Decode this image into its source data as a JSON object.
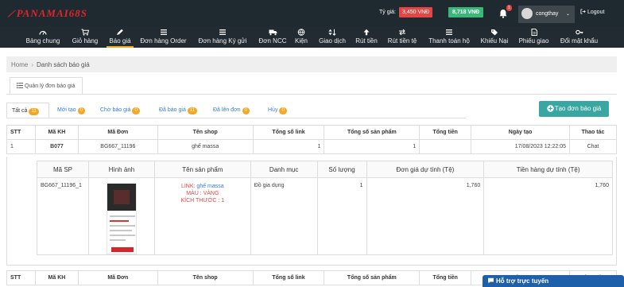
{
  "header": {
    "logo": "PANAMAI68S",
    "rate_label": "Tỷ giá:",
    "rate_value": "3,450 VNĐ",
    "wallet_value": "8,718 VNĐ",
    "notif_count": "1",
    "username": "congthay",
    "logout": "Logout"
  },
  "nav": {
    "items": [
      {
        "label": "Bảng chung",
        "icon": "dashboard-icon"
      },
      {
        "label": "Giỏ hàng",
        "icon": "cart-icon"
      },
      {
        "label": "Báo giá",
        "icon": "pencil-icon"
      },
      {
        "label": "Đơn hàng Order",
        "icon": "list-icon"
      },
      {
        "label": "Đơn hàng Ký gửi",
        "icon": "list-icon"
      },
      {
        "label": "Đơn NCC",
        "icon": "truck-icon"
      },
      {
        "label": "Kiện",
        "icon": "globe-icon"
      },
      {
        "label": "Giao dịch",
        "icon": "sort-icon"
      },
      {
        "label": "Rút tiền",
        "icon": "arrow-up-icon"
      },
      {
        "label": "Rút tiền tệ",
        "icon": "exchange-icon"
      },
      {
        "label": "Thanh toán hộ",
        "icon": "list-icon"
      },
      {
        "label": "Khiếu Nại",
        "icon": "tag-icon"
      },
      {
        "label": "Phiếu giao",
        "icon": "file-icon"
      },
      {
        "label": "Đổi mật khẩu",
        "icon": "key-icon"
      }
    ],
    "active_index": 2
  },
  "breadcrumb": {
    "home": "Home",
    "current": "Danh sách báo giá"
  },
  "section_tab": "Quản lý đơn báo giá",
  "filter_tabs": [
    {
      "label": "Tất cả",
      "count": "11"
    },
    {
      "label": "Mới tạo",
      "count": "0"
    },
    {
      "label": "Chờ báo giá",
      "count": "0"
    },
    {
      "label": "Đã báo giá",
      "count": "11"
    },
    {
      "label": "Đã lên đơn",
      "count": "0"
    },
    {
      "label": "Hủy",
      "count": "0"
    }
  ],
  "create_button": "Tạo đơn báo giá",
  "table": {
    "headers": [
      "STT",
      "Mã KH",
      "Mã Đơn",
      "Tên shop",
      "Tổng số link",
      "Tổng số sản phẩm",
      "Tổng tiền",
      "Ngày tạo",
      "Thao tác"
    ],
    "row": {
      "stt": "1",
      "ma_kh": "B077",
      "ma_don": "BG667_11196",
      "ten_shop": "ghế massa",
      "tong_link": "1",
      "tong_sp": "1",
      "tong_tien": "",
      "ngay_tao": "17/08/2023 12:22:05",
      "thao_tac": "Chat"
    }
  },
  "detail": {
    "headers": [
      "Mã SP",
      "Hình ảnh",
      "Tên sản phẩm",
      "Danh mục",
      "Số lượng",
      "Đơn giá dự tính (Tệ)",
      "Tiền hàng dự tính (Tệ)"
    ],
    "row": {
      "ma_sp": "BG667_11196_1",
      "link_label": "LINK:",
      "link_text": "ghế massa",
      "color": "MÀU : VÀNG",
      "size": "KÍCH THƯỚC : 1",
      "danh_muc": "Đồ gia dụng",
      "so_luong": "1",
      "don_gia": "1,760",
      "tien_hang": "1,760"
    }
  },
  "chat_widget": "Hỗ trợ trực tuyến"
}
